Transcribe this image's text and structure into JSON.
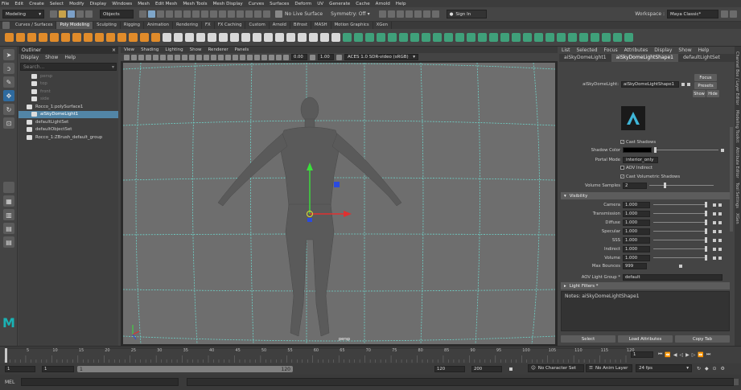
{
  "menubar": [
    "File",
    "Edit",
    "Create",
    "Select",
    "Modify",
    "Display",
    "Windows",
    "Mesh",
    "Edit Mesh",
    "Mesh Tools",
    "Mesh Display",
    "Curves",
    "Surfaces",
    "Deform",
    "UV",
    "Generate",
    "Cache",
    "Arnold",
    "Help"
  ],
  "statusline": {
    "menuset": "Modeling",
    "selection_mode": "Objects",
    "live_surface": "No Live Surface",
    "symmetry": "Symmetry: Off",
    "sign_in": "Sign In",
    "workspace_label": "Workspace :",
    "workspace": "Maya Classic*"
  },
  "shelf_tabs": [
    "Curves / Surfaces",
    "Poly Modeling",
    "Sculpting",
    "Rigging",
    "Animation",
    "Rendering",
    "FX",
    "FX Caching",
    "Custom",
    "Arnold",
    "Bifrost",
    "MASH",
    "Motion Graphics",
    "XGen"
  ],
  "shelf_active": "Poly Modeling",
  "colors": {
    "shelf_orange": "#e08b2a",
    "shelf_green": "#3fa07a",
    "selection_blue": "#5285a6",
    "maya_logo": "#1ab2b4"
  },
  "outliner": {
    "title": "Outliner",
    "menu": [
      "Display",
      "Show",
      "Help"
    ],
    "search_placeholder": "Search...",
    "items": [
      {
        "label": "persp",
        "dim": true,
        "icon": "camera-icon"
      },
      {
        "label": "top",
        "dim": true,
        "icon": "camera-icon"
      },
      {
        "label": "front",
        "dim": true,
        "icon": "camera-icon"
      },
      {
        "label": "side",
        "dim": true,
        "icon": "camera-icon"
      },
      {
        "label": "Rocco_1:polySurface1",
        "dim": false,
        "icon": "mesh-icon"
      },
      {
        "label": "aiSkyDomeLight1",
        "dim": false,
        "icon": "light-icon",
        "selected": true
      },
      {
        "label": "defaultLightSet",
        "dim": false,
        "icon": "set-icon"
      },
      {
        "label": "defaultObjectSet",
        "dim": false,
        "icon": "set-icon"
      },
      {
        "label": "Rocco_1:ZBrush_default_group",
        "dim": false,
        "icon": "group-icon"
      }
    ]
  },
  "viewport": {
    "menu": [
      "View",
      "Shading",
      "Lighting",
      "Show",
      "Renderer",
      "Panels"
    ],
    "val1": "0.00",
    "val2": "1.00",
    "colorspace": "ACES 1.0 SDR-video (sRGB)",
    "camera_label": "persp"
  },
  "attr": {
    "menu": [
      "List",
      "Selected",
      "Focus",
      "Attributes",
      "Display",
      "Show",
      "Help"
    ],
    "tabs": [
      "aiSkyDomeLight1",
      "aiSkyDomeLightShape1",
      "defaultLightSet"
    ],
    "active_tab": "aiSkyDomeLightShape1",
    "node_label": "aiSkyDomeLight:",
    "node_value": "aiSkyDomeLightShape1",
    "focus_btn": "Focus",
    "presets_btn": "Presets",
    "show_btn": "Show",
    "hide_btn": "Hide",
    "cast_shadows": "Cast Shadows",
    "shadow_color": "Shadow Color",
    "portal_mode_label": "Portal Mode",
    "portal_mode": "interior_only",
    "aov_indirect": "AOV Indirect",
    "cast_vol_shadows": "Cast Volumetric Shadows",
    "volume_samples_label": "Volume Samples",
    "volume_samples": "2",
    "visibility_section": "Visibility",
    "visibility": [
      {
        "label": "Camera",
        "value": "1.000"
      },
      {
        "label": "Transmission",
        "value": "1.000"
      },
      {
        "label": "Diffuse",
        "value": "1.000"
      },
      {
        "label": "Specular",
        "value": "1.000"
      },
      {
        "label": "SSS",
        "value": "1.000"
      },
      {
        "label": "Indirect",
        "value": "1.000"
      },
      {
        "label": "Volume",
        "value": "1.000"
      }
    ],
    "max_bounces_label": "Max Bounces",
    "max_bounces": "999",
    "aov_group_label": "AOV Light Group *",
    "aov_group": "default",
    "light_filters": "Light Filters *",
    "notes": "Notes:  aiSkyDomeLightShape1",
    "select_btn": "Select",
    "load_btn": "Load Attributes",
    "copy_btn": "Copy Tab"
  },
  "side_tabs": [
    "Channel Box / Layer Editor",
    "Modeling Toolkit",
    "Attribute Editor",
    "Tool Settings",
    "XGen"
  ],
  "timeline": {
    "ticks": [
      "5",
      "10",
      "15",
      "20",
      "25",
      "30",
      "35",
      "40",
      "45",
      "50",
      "55",
      "60",
      "65",
      "70",
      "75",
      "80",
      "85",
      "90",
      "95",
      "100",
      "105",
      "110",
      "115",
      "120"
    ],
    "current_frame": "1"
  },
  "range": {
    "start": "1",
    "range_start": "1",
    "range_inner_start": "1",
    "range_end_inner": "120",
    "range_end": "120",
    "anim_end": "200",
    "character_set": "No Character Set",
    "anim_layer": "No Anim Layer",
    "fps": "24 fps"
  },
  "cmdline": {
    "label": "MEL"
  }
}
